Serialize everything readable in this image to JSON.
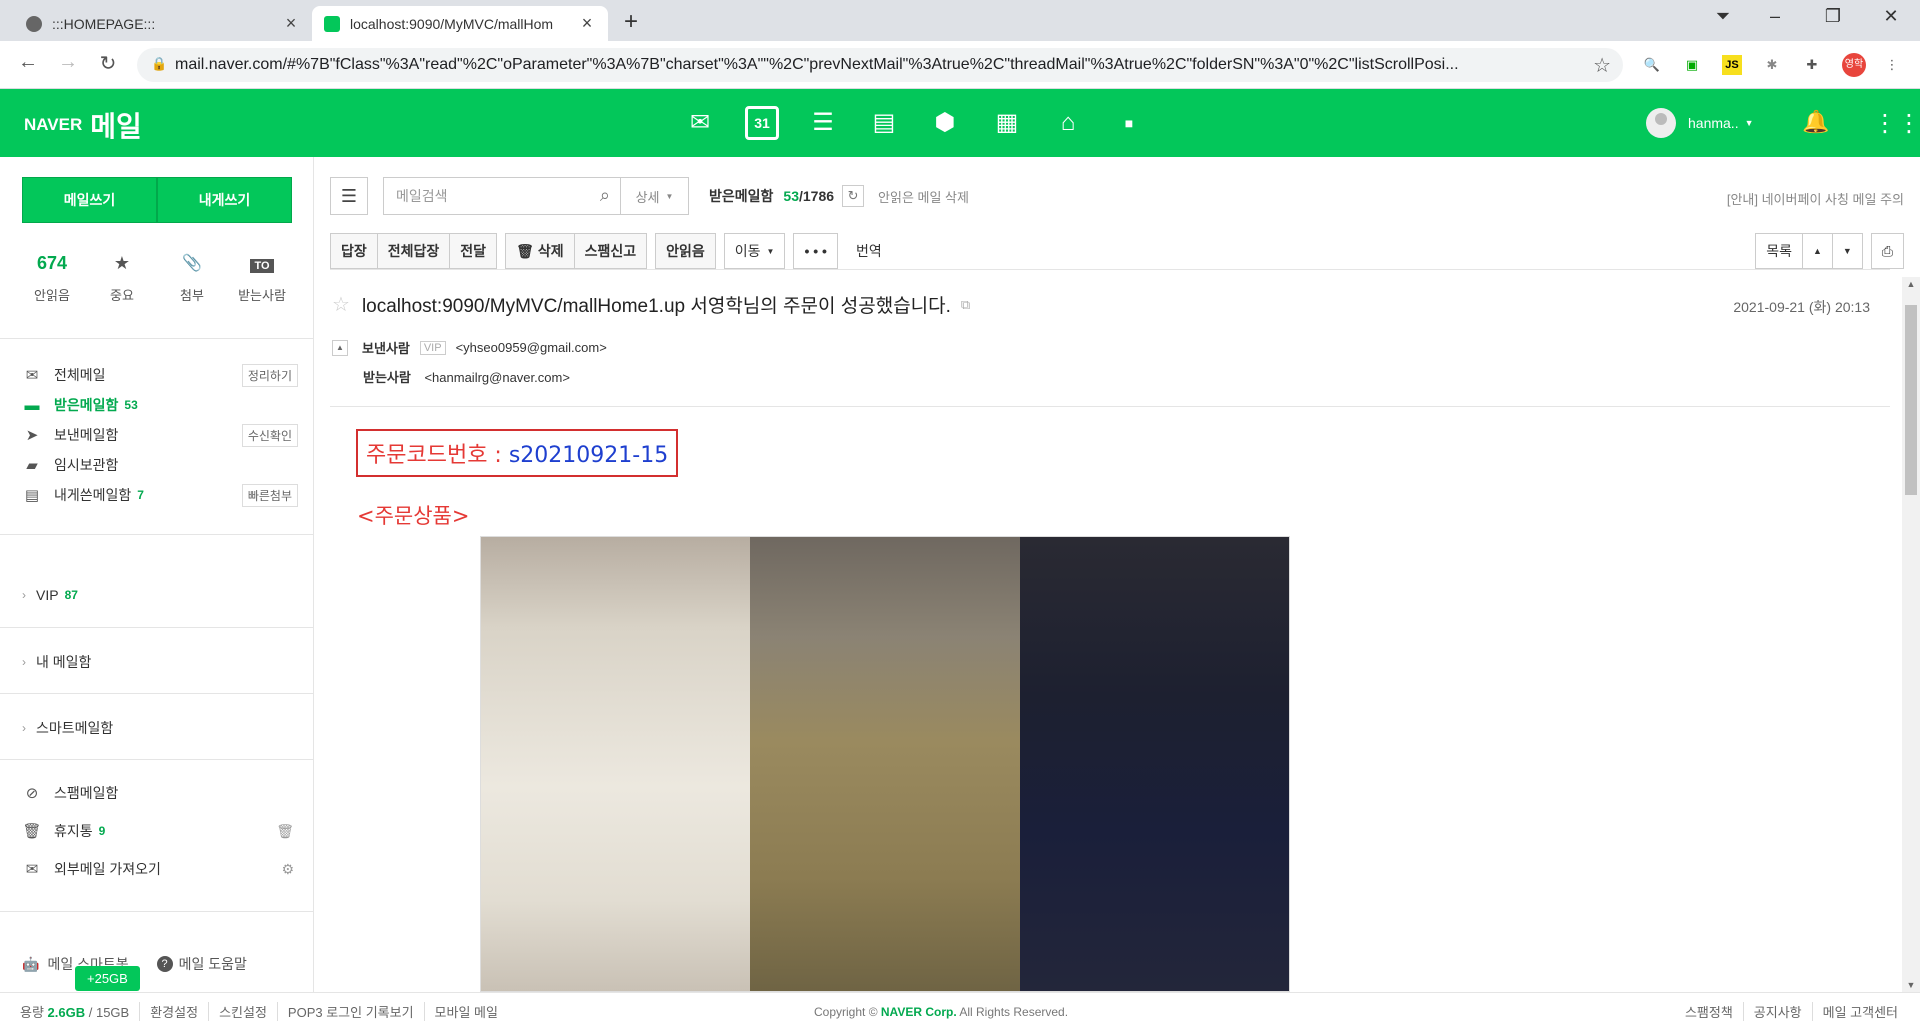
{
  "browser": {
    "tabs": [
      {
        "title": ":::HOMEPAGE:::"
      },
      {
        "title": "localhost:9090/MyMVC/mallHom"
      }
    ],
    "url": "mail.naver.com/#%7B\"fClass\"%3A\"read\"%2C\"oParameter\"%3A%7B\"charset\"%3A\"\"%2C\"prevNextMail\"%3Atrue%2C\"threadMail\"%3Atrue%2C\"folderSN\"%3A\"0\"%2C\"listScrollPosi...",
    "profile_badge": "영학",
    "ext_js": "JS"
  },
  "header": {
    "logo_naver": "NAVER",
    "logo_mail": "메일",
    "calendar_num": "31",
    "user_name": "hanma.."
  },
  "sidebar": {
    "write_mail": "메일쓰기",
    "write_to_me": "내게쓰기",
    "quick": [
      {
        "value": "674",
        "label": "안읽음"
      },
      {
        "value": "★",
        "label": "중요"
      },
      {
        "value": "📎",
        "label": "첨부"
      },
      {
        "value": "TO",
        "label": "받는사람"
      }
    ],
    "boxes": [
      {
        "label": "전체메일",
        "action": "정리하기"
      },
      {
        "label": "받은메일함",
        "count": "53"
      },
      {
        "label": "보낸메일함",
        "action": "수신확인"
      },
      {
        "label": "임시보관함"
      },
      {
        "label": "내게쓴메일함",
        "count": "7",
        "action": "빠른첨부"
      }
    ],
    "groups": [
      {
        "label": "VIP",
        "count": "87"
      },
      {
        "label": "내 메일함"
      },
      {
        "label": "스마트메일함"
      }
    ],
    "spam": "스팸메일함",
    "trash": "휴지통",
    "trash_count": "9",
    "external": "외부메일 가져오기",
    "smartbot": "메일 스마트봇",
    "help": "메일 도움말",
    "storage_badge": "+25GB"
  },
  "toolbar": {
    "search_placeholder": "메일검색",
    "detail": "상세",
    "folder_name": "받은메일함",
    "unread": "53",
    "total": "/1786",
    "delete_unread": "안읽은 메일 삭제",
    "notice": "[안내] 네이버페이 사칭 메일 주의",
    "reply": "답장",
    "reply_all": "전체답장",
    "forward": "전달",
    "delete": "삭제",
    "spam_report": "스팸신고",
    "mark_unread": "안읽음",
    "move": "이동",
    "more": "• • •",
    "translate": "번역",
    "list": "목록"
  },
  "mail": {
    "subject": "localhost:9090/MyMVC/mallHome1.up 서영학님의 주문이 성공했습니다.",
    "date": "2021-09-21 (화) 20:13",
    "from_label": "보낸사람",
    "vip": "VIP",
    "from": "<yhseo0959@gmail.com>",
    "to_label": "받는사람",
    "to": "<hanmailrg@naver.com>",
    "order_code_label": "주문코드번호 : ",
    "order_code": "s20210921-15",
    "product_label": "<주문상품>"
  },
  "footer": {
    "capacity_label": "용량",
    "used": "2.6GB",
    "total": "/ 15GB",
    "links": [
      "환경설정",
      "스킨설정",
      "POP3 로그인 기록보기",
      "모바일 메일"
    ],
    "copyright_pre": "Copyright ©",
    "copyright_corp": "NAVER Corp.",
    "copyright_post": "All Rights Reserved.",
    "right_links": [
      "스팸정책",
      "공지사항",
      "메일 고객센터"
    ]
  },
  "colors": {
    "naver_green": "#03c75a",
    "order_red": "#e53935",
    "order_blue": "#1e3fcf"
  }
}
